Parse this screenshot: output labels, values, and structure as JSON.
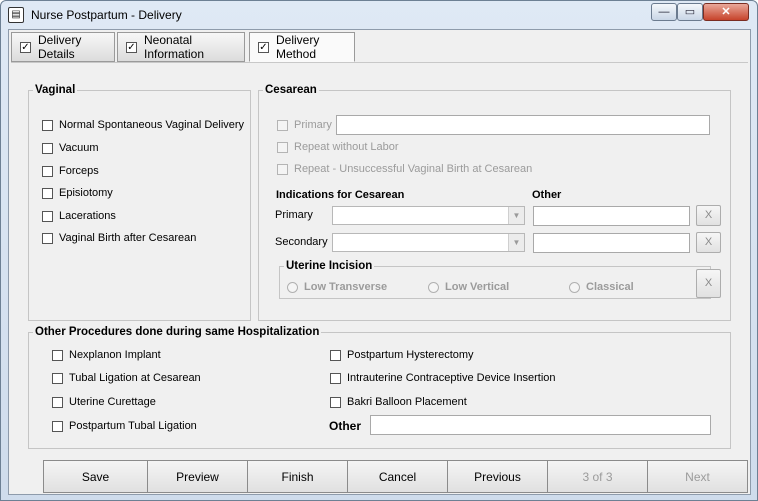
{
  "window": {
    "title": "Nurse Postpartum - Delivery",
    "min_glyph": "—",
    "max_glyph": "▭",
    "close_glyph": "✕"
  },
  "tabs": [
    {
      "label": "Delivery Details",
      "checked": true
    },
    {
      "label": "Neonatal Information",
      "checked": true
    },
    {
      "label": "Delivery Method",
      "checked": true,
      "active": true
    }
  ],
  "vaginal": {
    "legend": "Vaginal",
    "items": [
      "Normal Spontaneous Vaginal Delivery",
      "Vacuum",
      "Forceps",
      "Episiotomy",
      "Lacerations",
      "Vaginal Birth after Cesarean"
    ]
  },
  "cesarean": {
    "legend": "Cesarean",
    "primary_label": "Primary",
    "primary_value": "",
    "repeat_no_labor": "Repeat without Labor",
    "repeat_unsuccessful": "Repeat - Unsuccessful Vaginal Birth at Cesarean",
    "indications_heading": "Indications for Cesarean",
    "other_heading": "Other",
    "primary_row_label": "Primary",
    "secondary_row_label": "Secondary",
    "primary_indication": "",
    "secondary_indication": "",
    "primary_other": "",
    "secondary_other": "",
    "clear_label": "X"
  },
  "uterine_incision": {
    "legend": "Uterine Incision",
    "options": [
      "Low Transverse",
      "Low Vertical",
      "Classical"
    ],
    "clear_label": "X"
  },
  "other_procedures": {
    "legend": "Other Procedures done during same Hospitalization",
    "left": [
      "Nexplanon Implant",
      "Tubal Ligation at Cesarean",
      "Uterine Curettage",
      "Postpartum Tubal Ligation"
    ],
    "right": [
      "Postpartum Hysterectomy",
      "Intrauterine Contraceptive Device Insertion",
      "Bakri Balloon Placement"
    ],
    "other_label": "Other",
    "other_value": ""
  },
  "buttons": {
    "save": "Save",
    "preview": "Preview",
    "finish": "Finish",
    "cancel": "Cancel",
    "previous": "Previous",
    "page": "3 of 3",
    "next": "Next"
  },
  "icons": {
    "check": "✓",
    "dropdown": "▼",
    "window": "▤"
  }
}
